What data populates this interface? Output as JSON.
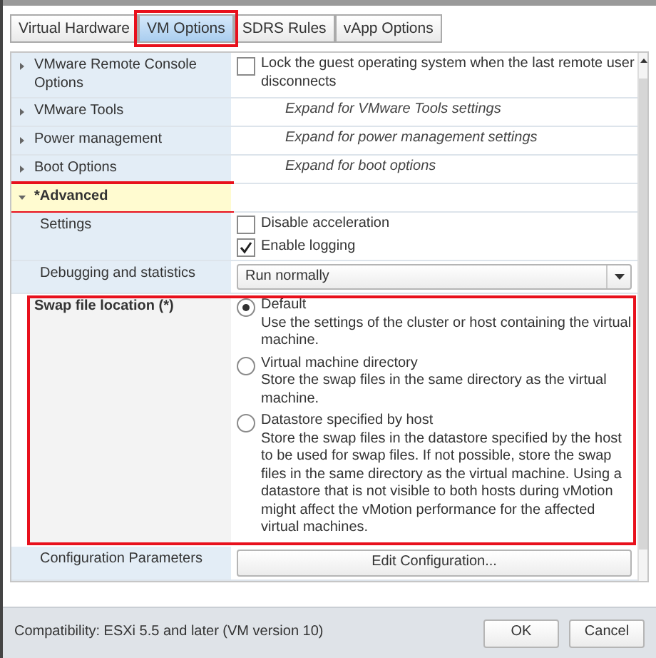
{
  "tabs": [
    {
      "label": "Virtual Hardware",
      "selected": false,
      "highlighted": false
    },
    {
      "label": "VM Options",
      "selected": true,
      "highlighted": true
    },
    {
      "label": "SDRS Rules",
      "selected": false,
      "highlighted": false
    },
    {
      "label": "vApp Options",
      "selected": false,
      "highlighted": false
    }
  ],
  "rows": [
    {
      "kind": "section",
      "label": "VMware Remote Console Options",
      "expanded": false,
      "highlighted": false,
      "content": {
        "kind": "checkbox",
        "label": "Lock the guest operating system when the last remote user disconnects",
        "checked": false
      }
    },
    {
      "kind": "section",
      "label": "VMware Tools",
      "expanded": false,
      "highlighted": false,
      "content": {
        "kind": "hint",
        "text": "Expand for VMware Tools settings"
      }
    },
    {
      "kind": "section",
      "label": "Power management",
      "expanded": false,
      "highlighted": false,
      "content": {
        "kind": "hint",
        "text": "Expand for power management settings"
      }
    },
    {
      "kind": "section",
      "label": "Boot Options",
      "expanded": false,
      "highlighted": false,
      "content": {
        "kind": "hint",
        "text": "Expand for boot options"
      }
    },
    {
      "kind": "section",
      "label": "*Advanced",
      "expanded": true,
      "highlighted": true
    },
    {
      "kind": "setting",
      "label": "Settings",
      "content": {
        "kind": "checkboxes",
        "items": [
          {
            "label": "Disable acceleration",
            "checked": false
          },
          {
            "label": "Enable logging",
            "checked": true
          }
        ]
      }
    },
    {
      "kind": "setting",
      "label": "Debugging and statistics",
      "content": {
        "kind": "select",
        "value": "Run normally"
      }
    },
    {
      "kind": "group",
      "label": "Swap file location (*)",
      "highlighted": true,
      "content": {
        "kind": "radios",
        "items": [
          {
            "label": "Default",
            "description": "Use the settings of the cluster or host containing the virtual machine.",
            "selected": true
          },
          {
            "label": "Virtual machine directory",
            "description": "Store the swap files in the same directory as the virtual machine.",
            "selected": false
          },
          {
            "label": "Datastore specified by host",
            "description": "Store the swap files in the datastore specified by the host to be used for swap files. If not possible, store the swap files in the same directory as the virtual machine. Using a datastore that is not visible to both hosts during vMotion might affect the vMotion performance for the affected virtual machines.",
            "selected": false
          }
        ]
      }
    },
    {
      "kind": "setting",
      "label": "Configuration Parameters",
      "content": {
        "kind": "button",
        "label": "Edit Configuration..."
      }
    }
  ],
  "footer": {
    "compatibility": "Compatibility: ESXi 5.5 and later (VM version 10)",
    "buttons": [
      "OK",
      "Cancel"
    ]
  }
}
